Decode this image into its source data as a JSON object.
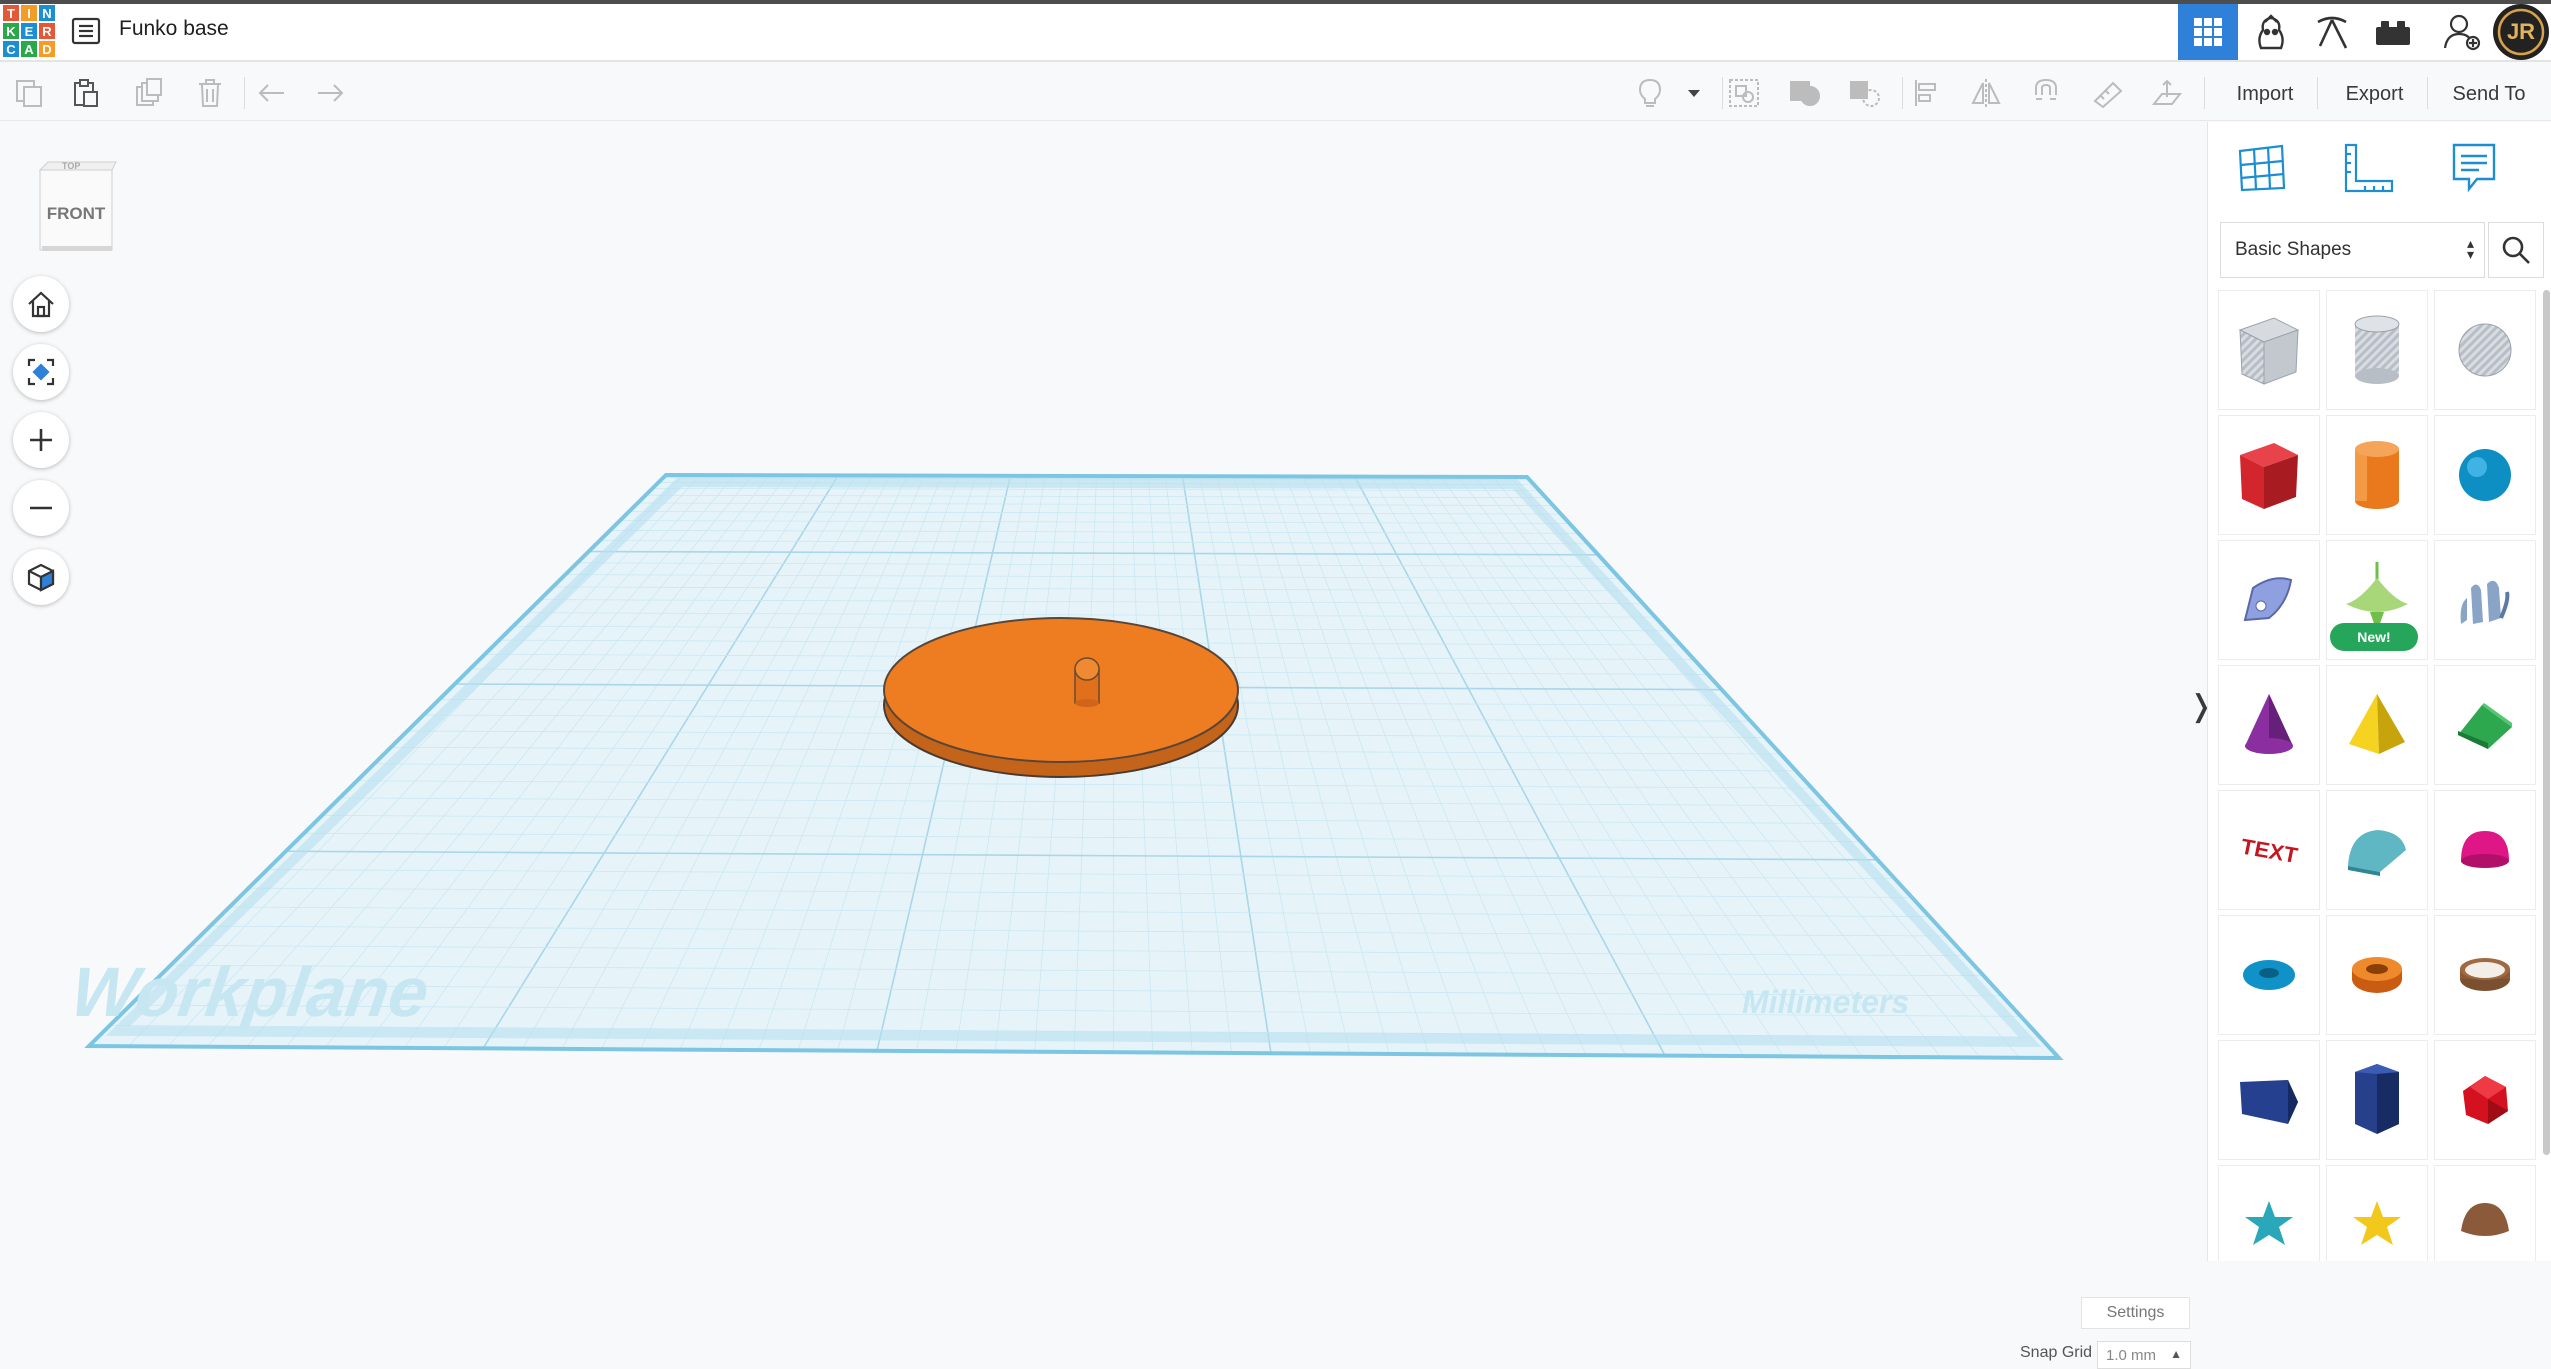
{
  "app": {
    "logo_letters": [
      "T",
      "I",
      "N",
      "K",
      "E",
      "R",
      "C",
      "A",
      "D"
    ],
    "document_title": "Funko base"
  },
  "topnav": [
    {
      "name": "3d-design-view-icon",
      "active": true
    },
    {
      "name": "blocks-icon",
      "active": false
    },
    {
      "name": "pickaxe-icon",
      "active": false
    },
    {
      "name": "bricks-icon",
      "active": false
    },
    {
      "name": "add-user-icon",
      "active": false
    }
  ],
  "user": {
    "initials": "JR"
  },
  "toolbar": {
    "left_tools": [
      "copy-icon",
      "paste-icon",
      "duplicate-icon",
      "delete-icon",
      "undo-icon",
      "redo-icon"
    ],
    "right_tools": [
      "light-bulb-icon",
      "dropdown-arrow-icon",
      "group-icon",
      "union-icon",
      "hole-icon",
      "align-icon",
      "mirror-icon",
      "magnet-icon",
      "ruler-icon",
      "workplane-tool-icon"
    ],
    "import_label": "Import",
    "export_label": "Export",
    "sendto_label": "Send To"
  },
  "viewcube": {
    "front_label": "FRONT",
    "top_label": "TOP"
  },
  "workplane": {
    "label": "Workplane",
    "units_label": "Millimeters"
  },
  "canvas_controls": [
    "home-icon",
    "fit-view-icon",
    "zoom-in-icon",
    "zoom-out-icon",
    "projection-cube-icon"
  ],
  "settings_label": "Settings",
  "snap_grid": {
    "label": "Snap Grid",
    "value": "1.0 mm"
  },
  "panel": {
    "tabs": [
      "workplane-grid-icon",
      "ruler-corner-icon",
      "notes-icon"
    ],
    "category": "Basic Shapes",
    "new_badge": "New!",
    "text_shape_label": "TEXT",
    "shapes": [
      "box-hole",
      "cylinder-hole",
      "sphere-hole",
      "box",
      "cylinder",
      "sphere",
      "scribble",
      "spinner",
      "shape-generator",
      "cone",
      "pyramid",
      "roof",
      "text",
      "round-roof",
      "half-sphere",
      "torus",
      "tube",
      "ring",
      "wedge",
      "hexagonal-prism",
      "polyhedron",
      "star",
      "star",
      "paraboloid"
    ]
  },
  "colors": {
    "accent": "#2e80d8",
    "disc_orange": "#ee7d22",
    "workplane": "#dff1f8",
    "new_badge": "#26a65b"
  }
}
